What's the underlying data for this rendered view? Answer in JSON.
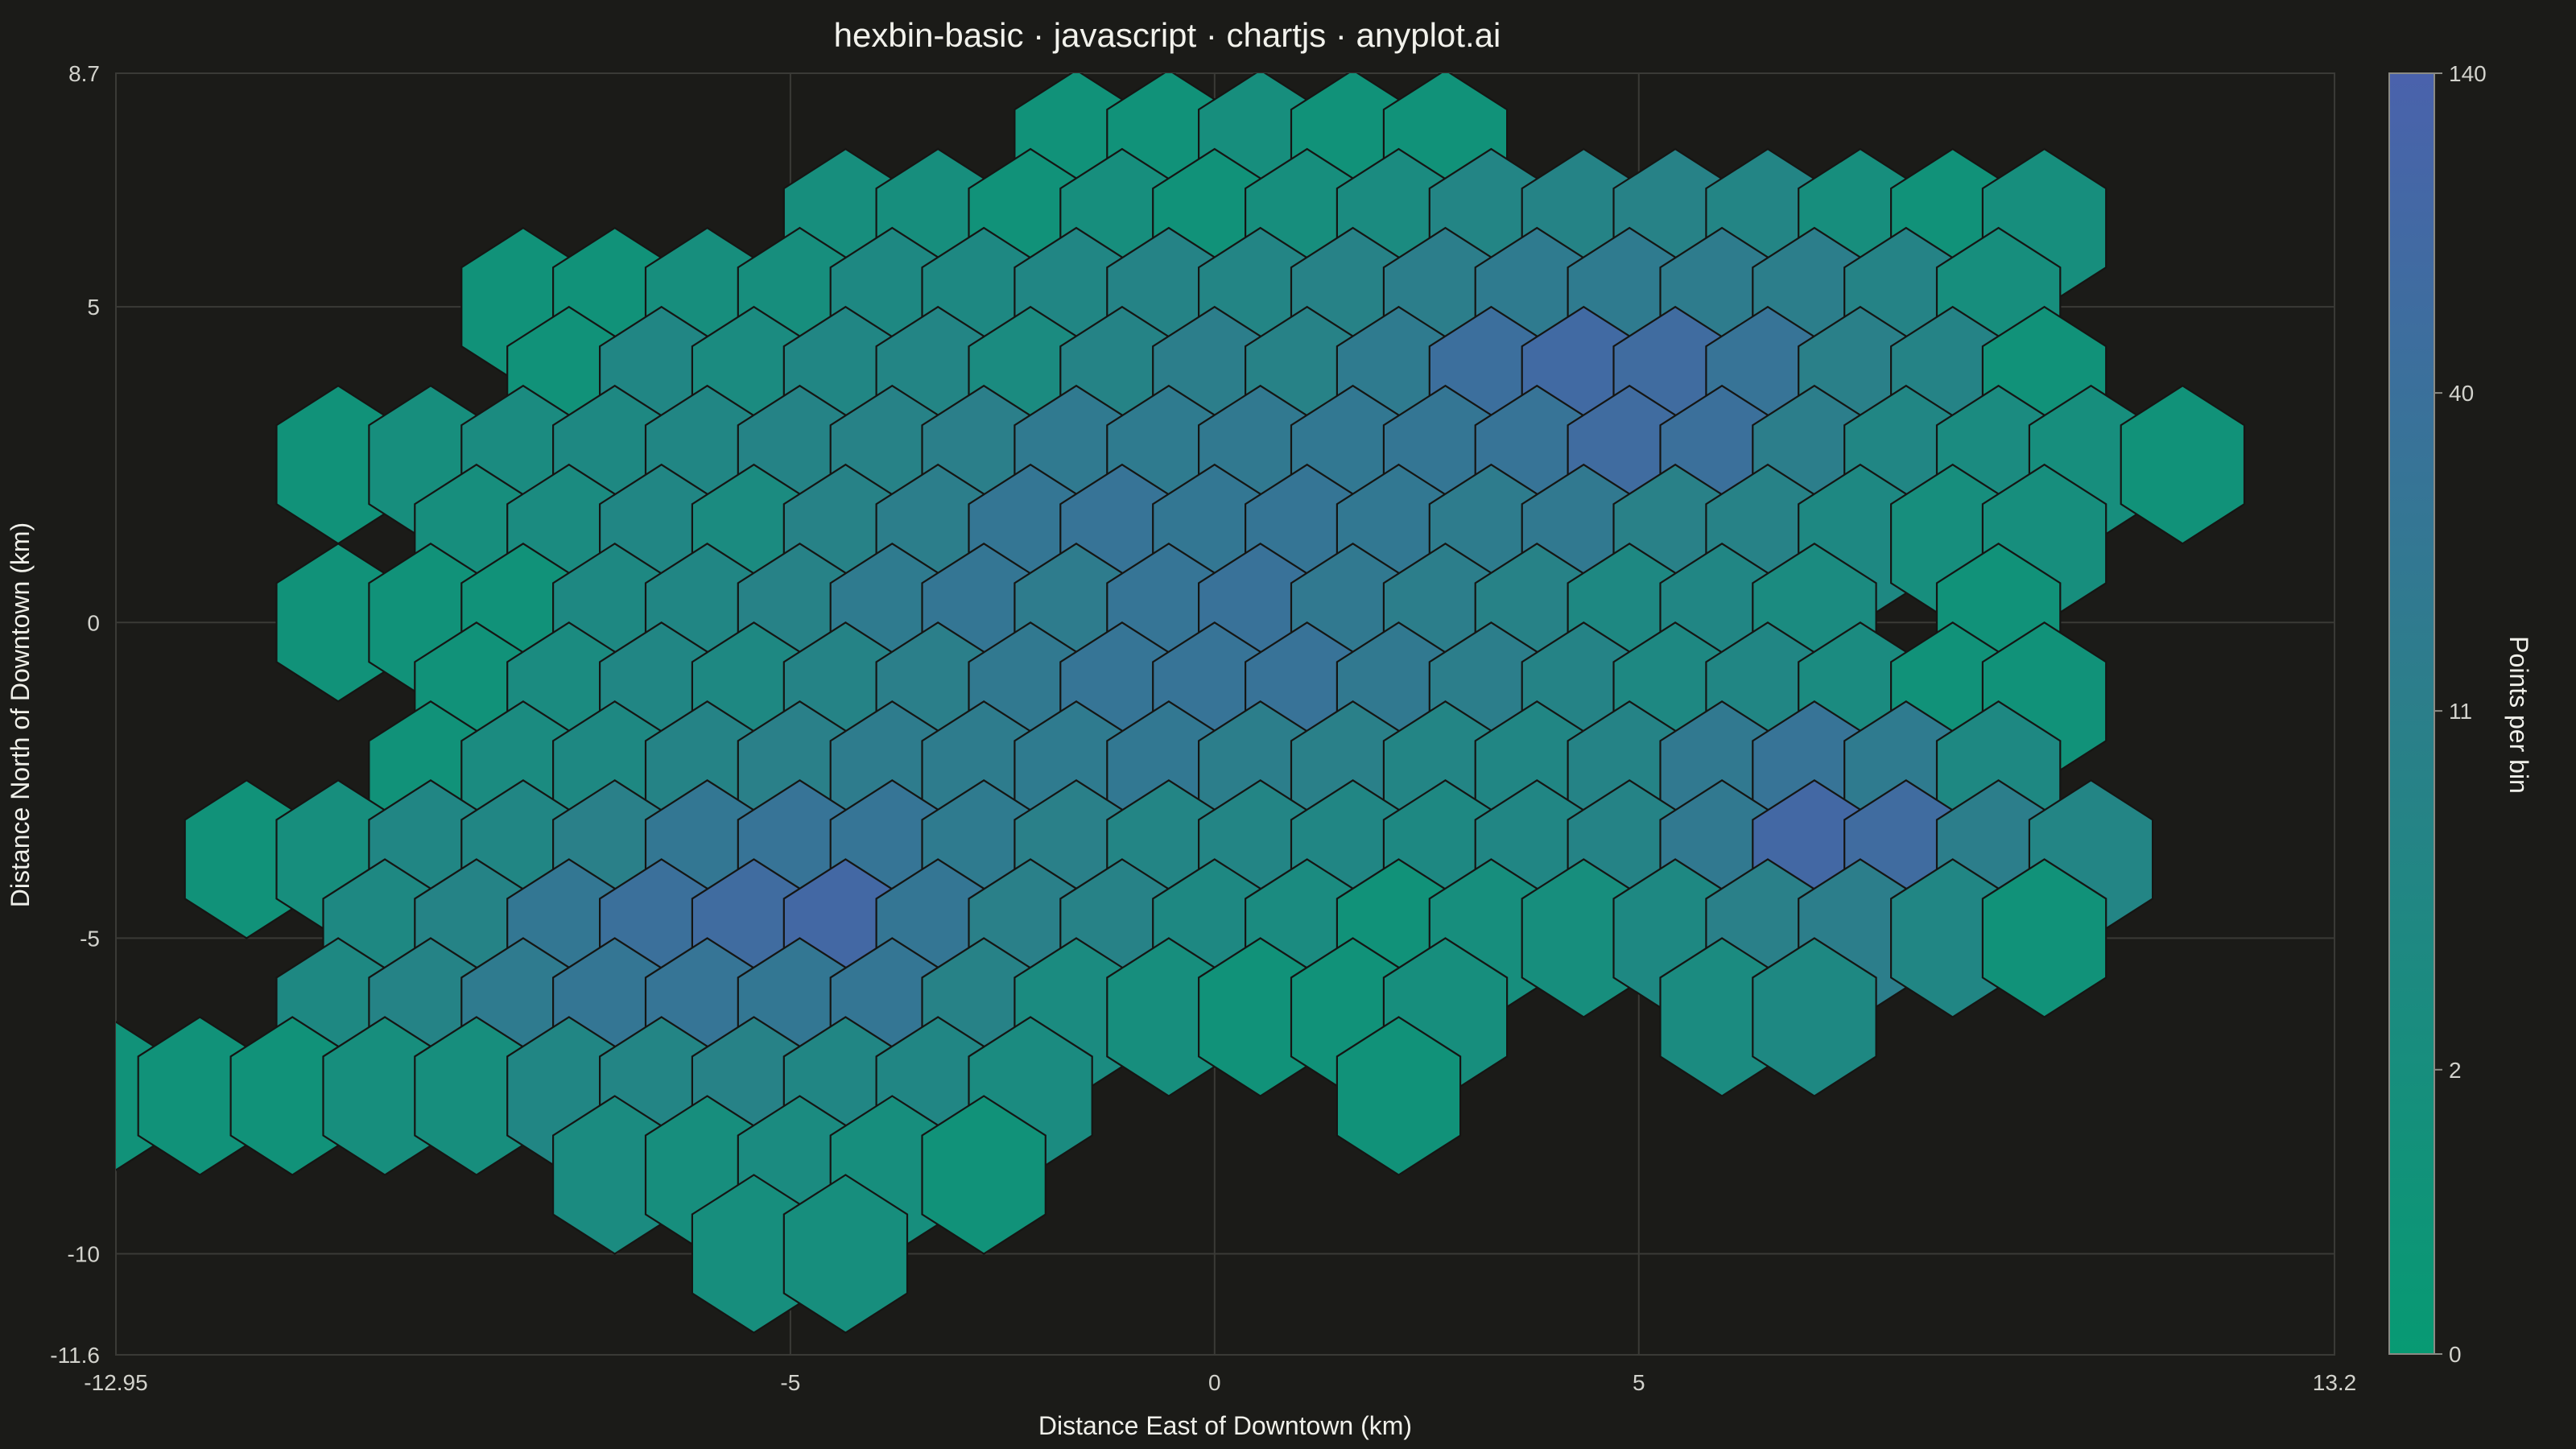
{
  "chart_data": {
    "type": "heatmap",
    "subtype": "hexbin",
    "title": "hexbin-basic · javascript · chartjs · anyplot.ai",
    "xlabel": "Distance East of Downtown (km)",
    "ylabel": "Distance North of Downtown (km)",
    "xlim": [
      -12.95,
      13.2
    ],
    "ylim": [
      -11.6,
      8.7
    ],
    "x_ticks": [
      -12.95,
      -5,
      0,
      5,
      13.2
    ],
    "y_ticks": [
      8.7,
      5,
      0,
      -5,
      -10,
      -11.6
    ],
    "grid": true,
    "hex_radius_km": 1.25,
    "colorbar": {
      "label": "Points per bin",
      "scale": "log",
      "ticks": [
        140,
        40,
        11,
        2,
        0
      ],
      "range": [
        0,
        140
      ],
      "color_low": "#079a73",
      "color_high": "#4a62ac"
    },
    "bins": [
      {
        "x": -1.63,
        "y": 7.5,
        "count": 1
      },
      {
        "x": -0.54,
        "y": 7.5,
        "count": 1
      },
      {
        "x": 0.54,
        "y": 7.5,
        "count": 2
      },
      {
        "x": 1.63,
        "y": 7.5,
        "count": 1
      },
      {
        "x": 2.72,
        "y": 7.5,
        "count": 1
      },
      {
        "x": -4.35,
        "y": 6.25,
        "count": 2
      },
      {
        "x": -3.26,
        "y": 6.25,
        "count": 2
      },
      {
        "x": -2.17,
        "y": 6.25,
        "count": 1
      },
      {
        "x": -1.09,
        "y": 6.25,
        "count": 2
      },
      {
        "x": 0.0,
        "y": 6.25,
        "count": 1
      },
      {
        "x": 1.09,
        "y": 6.25,
        "count": 2
      },
      {
        "x": 2.17,
        "y": 6.25,
        "count": 3
      },
      {
        "x": 3.26,
        "y": 6.25,
        "count": 6
      },
      {
        "x": 4.35,
        "y": 6.25,
        "count": 7
      },
      {
        "x": 5.43,
        "y": 6.25,
        "count": 8
      },
      {
        "x": 6.52,
        "y": 6.25,
        "count": 6
      },
      {
        "x": 7.61,
        "y": 6.25,
        "count": 2
      },
      {
        "x": 8.7,
        "y": 6.25,
        "count": 1
      },
      {
        "x": 9.78,
        "y": 6.25,
        "count": 2
      },
      {
        "x": -8.15,
        "y": 5.0,
        "count": 1
      },
      {
        "x": -7.07,
        "y": 5.0,
        "count": 1
      },
      {
        "x": -5.98,
        "y": 5.0,
        "count": 2
      },
      {
        "x": -4.89,
        "y": 5.0,
        "count": 2
      },
      {
        "x": -3.8,
        "y": 5.0,
        "count": 4
      },
      {
        "x": -2.72,
        "y": 5.0,
        "count": 4
      },
      {
        "x": -1.63,
        "y": 5.0,
        "count": 5
      },
      {
        "x": -0.54,
        "y": 5.0,
        "count": 7
      },
      {
        "x": 0.54,
        "y": 5.0,
        "count": 6
      },
      {
        "x": 1.63,
        "y": 5.0,
        "count": 8
      },
      {
        "x": 2.72,
        "y": 5.0,
        "count": 12
      },
      {
        "x": 3.8,
        "y": 5.0,
        "count": 16
      },
      {
        "x": 4.89,
        "y": 5.0,
        "count": 16
      },
      {
        "x": 5.98,
        "y": 5.0,
        "count": 14
      },
      {
        "x": 7.07,
        "y": 5.0,
        "count": 12
      },
      {
        "x": 8.15,
        "y": 5.0,
        "count": 7
      },
      {
        "x": 9.24,
        "y": 5.0,
        "count": 2
      },
      {
        "x": -7.61,
        "y": 3.75,
        "count": 1
      },
      {
        "x": -6.52,
        "y": 3.75,
        "count": 5
      },
      {
        "x": -5.43,
        "y": 3.75,
        "count": 3
      },
      {
        "x": -4.35,
        "y": 3.75,
        "count": 5
      },
      {
        "x": -3.26,
        "y": 3.75,
        "count": 6
      },
      {
        "x": -2.17,
        "y": 3.75,
        "count": 3
      },
      {
        "x": -1.09,
        "y": 3.75,
        "count": 7
      },
      {
        "x": 0.0,
        "y": 3.75,
        "count": 12
      },
      {
        "x": 1.09,
        "y": 3.75,
        "count": 8
      },
      {
        "x": 2.17,
        "y": 3.75,
        "count": 16
      },
      {
        "x": 3.26,
        "y": 3.75,
        "count": 45
      },
      {
        "x": 4.35,
        "y": 3.75,
        "count": 70
      },
      {
        "x": 5.43,
        "y": 3.75,
        "count": 60
      },
      {
        "x": 6.52,
        "y": 3.75,
        "count": 30
      },
      {
        "x": 7.61,
        "y": 3.75,
        "count": 10
      },
      {
        "x": 8.7,
        "y": 3.75,
        "count": 7
      },
      {
        "x": 9.78,
        "y": 3.75,
        "count": 1
      },
      {
        "x": -10.33,
        "y": 2.5,
        "count": 1
      },
      {
        "x": -9.24,
        "y": 2.5,
        "count": 2
      },
      {
        "x": -8.15,
        "y": 2.5,
        "count": 3
      },
      {
        "x": -7.07,
        "y": 2.5,
        "count": 4
      },
      {
        "x": -5.98,
        "y": 2.5,
        "count": 5
      },
      {
        "x": -4.89,
        "y": 2.5,
        "count": 7
      },
      {
        "x": -3.8,
        "y": 2.5,
        "count": 8
      },
      {
        "x": -2.72,
        "y": 2.5,
        "count": 11
      },
      {
        "x": -1.63,
        "y": 2.5,
        "count": 17
      },
      {
        "x": -0.54,
        "y": 2.5,
        "count": 16
      },
      {
        "x": 0.54,
        "y": 2.5,
        "count": 18
      },
      {
        "x": 1.63,
        "y": 2.5,
        "count": 20
      },
      {
        "x": 2.72,
        "y": 2.5,
        "count": 24
      },
      {
        "x": 3.8,
        "y": 2.5,
        "count": 30
      },
      {
        "x": 4.89,
        "y": 2.5,
        "count": 60
      },
      {
        "x": 5.98,
        "y": 2.5,
        "count": 40
      },
      {
        "x": 7.07,
        "y": 2.5,
        "count": 12
      },
      {
        "x": 8.15,
        "y": 2.5,
        "count": 5
      },
      {
        "x": 9.24,
        "y": 2.5,
        "count": 3
      },
      {
        "x": 10.33,
        "y": 2.5,
        "count": 2
      },
      {
        "x": 11.41,
        "y": 2.5,
        "count": 1
      },
      {
        "x": -8.7,
        "y": 1.25,
        "count": 2
      },
      {
        "x": -7.61,
        "y": 1.25,
        "count": 3
      },
      {
        "x": -6.52,
        "y": 1.25,
        "count": 5
      },
      {
        "x": -5.43,
        "y": 1.25,
        "count": 3
      },
      {
        "x": -4.35,
        "y": 1.25,
        "count": 8
      },
      {
        "x": -3.26,
        "y": 1.25,
        "count": 12
      },
      {
        "x": -2.17,
        "y": 1.25,
        "count": 24
      },
      {
        "x": -1.09,
        "y": 1.25,
        "count": 30
      },
      {
        "x": 0.0,
        "y": 1.25,
        "count": 22
      },
      {
        "x": 1.09,
        "y": 1.25,
        "count": 26
      },
      {
        "x": 2.17,
        "y": 1.25,
        "count": 20
      },
      {
        "x": 3.26,
        "y": 1.25,
        "count": 14
      },
      {
        "x": 4.35,
        "y": 1.25,
        "count": 18
      },
      {
        "x": 5.43,
        "y": 1.25,
        "count": 9
      },
      {
        "x": 6.52,
        "y": 1.25,
        "count": 8
      },
      {
        "x": 7.61,
        "y": 1.25,
        "count": 4
      },
      {
        "x": 8.7,
        "y": 1.25,
        "count": 2
      },
      {
        "x": 9.78,
        "y": 1.25,
        "count": 2
      },
      {
        "x": -10.33,
        "y": 0.0,
        "count": 1
      },
      {
        "x": -9.24,
        "y": 0.0,
        "count": 1
      },
      {
        "x": -8.15,
        "y": 0.0,
        "count": 1
      },
      {
        "x": -7.07,
        "y": 0.0,
        "count": 4
      },
      {
        "x": -5.98,
        "y": 0.0,
        "count": 5
      },
      {
        "x": -4.89,
        "y": 0.0,
        "count": 8
      },
      {
        "x": -3.8,
        "y": 0.0,
        "count": 16
      },
      {
        "x": -2.72,
        "y": 0.0,
        "count": 24
      },
      {
        "x": -1.63,
        "y": 0.0,
        "count": 14
      },
      {
        "x": -0.54,
        "y": 0.0,
        "count": 28
      },
      {
        "x": 0.54,
        "y": 0.0,
        "count": 34
      },
      {
        "x": 1.63,
        "y": 0.0,
        "count": 18
      },
      {
        "x": 2.72,
        "y": 0.0,
        "count": 12
      },
      {
        "x": 3.8,
        "y": 0.0,
        "count": 8
      },
      {
        "x": 4.89,
        "y": 0.0,
        "count": 4
      },
      {
        "x": 5.98,
        "y": 0.0,
        "count": 5
      },
      {
        "x": 7.07,
        "y": 0.0,
        "count": 3
      },
      {
        "x": 9.24,
        "y": 0.0,
        "count": 1
      },
      {
        "x": -8.7,
        "y": -1.25,
        "count": 1
      },
      {
        "x": -7.61,
        "y": -1.25,
        "count": 3
      },
      {
        "x": -6.52,
        "y": -1.25,
        "count": 5
      },
      {
        "x": -5.43,
        "y": -1.25,
        "count": 4
      },
      {
        "x": -4.35,
        "y": -1.25,
        "count": 7
      },
      {
        "x": -3.26,
        "y": -1.25,
        "count": 11
      },
      {
        "x": -2.17,
        "y": -1.25,
        "count": 18
      },
      {
        "x": -1.09,
        "y": -1.25,
        "count": 28
      },
      {
        "x": 0.0,
        "y": -1.25,
        "count": 30
      },
      {
        "x": 1.09,
        "y": -1.25,
        "count": 32
      },
      {
        "x": 2.17,
        "y": -1.25,
        "count": 18
      },
      {
        "x": 3.26,
        "y": -1.25,
        "count": 12
      },
      {
        "x": 4.35,
        "y": -1.25,
        "count": 7
      },
      {
        "x": 5.43,
        "y": -1.25,
        "count": 4
      },
      {
        "x": 6.52,
        "y": -1.25,
        "count": 5
      },
      {
        "x": 7.61,
        "y": -1.25,
        "count": 3
      },
      {
        "x": 8.7,
        "y": -1.25,
        "count": 1
      },
      {
        "x": 9.78,
        "y": -1.25,
        "count": 1
      },
      {
        "x": -9.24,
        "y": -2.5,
        "count": 1
      },
      {
        "x": -8.15,
        "y": -2.5,
        "count": 3
      },
      {
        "x": -7.07,
        "y": -2.5,
        "count": 4
      },
      {
        "x": -5.98,
        "y": -2.5,
        "count": 7
      },
      {
        "x": -4.89,
        "y": -2.5,
        "count": 10
      },
      {
        "x": -3.8,
        "y": -2.5,
        "count": 14
      },
      {
        "x": -2.72,
        "y": -2.5,
        "count": 14
      },
      {
        "x": -1.63,
        "y": -2.5,
        "count": 16
      },
      {
        "x": -0.54,
        "y": -2.5,
        "count": 20
      },
      {
        "x": 0.54,
        "y": -2.5,
        "count": 12
      },
      {
        "x": 1.63,
        "y": -2.5,
        "count": 10
      },
      {
        "x": 2.72,
        "y": -2.5,
        "count": 6
      },
      {
        "x": 3.8,
        "y": -2.5,
        "count": 5
      },
      {
        "x": 4.89,
        "y": -2.5,
        "count": 7
      },
      {
        "x": 5.98,
        "y": -2.5,
        "count": 18
      },
      {
        "x": 7.07,
        "y": -2.5,
        "count": 30
      },
      {
        "x": 8.15,
        "y": -2.5,
        "count": 16
      },
      {
        "x": 9.24,
        "y": -2.5,
        "count": 4
      },
      {
        "x": -11.41,
        "y": -3.75,
        "count": 1
      },
      {
        "x": -10.33,
        "y": -3.75,
        "count": 2
      },
      {
        "x": -9.24,
        "y": -3.75,
        "count": 5
      },
      {
        "x": -8.15,
        "y": -3.75,
        "count": 5
      },
      {
        "x": -7.07,
        "y": -3.75,
        "count": 10
      },
      {
        "x": -5.98,
        "y": -3.75,
        "count": 22
      },
      {
        "x": -4.89,
        "y": -3.75,
        "count": 30
      },
      {
        "x": -3.8,
        "y": -3.75,
        "count": 28
      },
      {
        "x": -2.72,
        "y": -3.75,
        "count": 16
      },
      {
        "x": -1.63,
        "y": -3.75,
        "count": 10
      },
      {
        "x": -0.54,
        "y": -3.75,
        "count": 6
      },
      {
        "x": 0.54,
        "y": -3.75,
        "count": 6
      },
      {
        "x": 1.63,
        "y": -3.75,
        "count": 5
      },
      {
        "x": 2.72,
        "y": -3.75,
        "count": 4
      },
      {
        "x": 3.8,
        "y": -3.75,
        "count": 5
      },
      {
        "x": 4.89,
        "y": -3.75,
        "count": 7
      },
      {
        "x": 5.98,
        "y": -3.75,
        "count": 18
      },
      {
        "x": 7.07,
        "y": -3.75,
        "count": 80
      },
      {
        "x": 8.15,
        "y": -3.75,
        "count": 60
      },
      {
        "x": 9.24,
        "y": -3.75,
        "count": 12
      },
      {
        "x": 10.33,
        "y": -3.75,
        "count": 6
      },
      {
        "x": -9.78,
        "y": -5.0,
        "count": 4
      },
      {
        "x": -8.7,
        "y": -5.0,
        "count": 7
      },
      {
        "x": -7.61,
        "y": -5.0,
        "count": 22
      },
      {
        "x": -6.52,
        "y": -5.0,
        "count": 40
      },
      {
        "x": -5.43,
        "y": -5.0,
        "count": 60
      },
      {
        "x": -4.35,
        "y": -5.0,
        "count": 80
      },
      {
        "x": -3.26,
        "y": -5.0,
        "count": 24
      },
      {
        "x": -2.17,
        "y": -5.0,
        "count": 10
      },
      {
        "x": -1.09,
        "y": -5.0,
        "count": 8
      },
      {
        "x": 0.0,
        "y": -5.0,
        "count": 4
      },
      {
        "x": 1.09,
        "y": -5.0,
        "count": 3
      },
      {
        "x": 2.17,
        "y": -5.0,
        "count": 1
      },
      {
        "x": 3.26,
        "y": -5.0,
        "count": 2
      },
      {
        "x": 4.35,
        "y": -5.0,
        "count": 2
      },
      {
        "x": 5.43,
        "y": -5.0,
        "count": 4
      },
      {
        "x": 6.52,
        "y": -5.0,
        "count": 10
      },
      {
        "x": 7.61,
        "y": -5.0,
        "count": 12
      },
      {
        "x": 8.7,
        "y": -5.0,
        "count": 5
      },
      {
        "x": 9.78,
        "y": -5.0,
        "count": 1
      },
      {
        "x": -10.33,
        "y": -6.25,
        "count": 4
      },
      {
        "x": -9.24,
        "y": -6.25,
        "count": 7
      },
      {
        "x": -8.15,
        "y": -6.25,
        "count": 16
      },
      {
        "x": -7.07,
        "y": -6.25,
        "count": 24
      },
      {
        "x": -5.98,
        "y": -6.25,
        "count": 28
      },
      {
        "x": -4.89,
        "y": -6.25,
        "count": 22
      },
      {
        "x": -3.8,
        "y": -6.25,
        "count": 24
      },
      {
        "x": -2.72,
        "y": -6.25,
        "count": 8
      },
      {
        "x": -1.63,
        "y": -6.25,
        "count": 3
      },
      {
        "x": -0.54,
        "y": -6.25,
        "count": 2
      },
      {
        "x": 0.54,
        "y": -6.25,
        "count": 1
      },
      {
        "x": 1.63,
        "y": -6.25,
        "count": 1
      },
      {
        "x": 2.72,
        "y": -6.25,
        "count": 2
      },
      {
        "x": 5.98,
        "y": -6.25,
        "count": 3
      },
      {
        "x": 7.07,
        "y": -6.25,
        "count": 4
      },
      {
        "x": -13.04,
        "y": -7.5,
        "count": 1
      },
      {
        "x": -11.96,
        "y": -7.5,
        "count": 1
      },
      {
        "x": -10.87,
        "y": -7.5,
        "count": 1
      },
      {
        "x": -9.78,
        "y": -7.5,
        "count": 2
      },
      {
        "x": -8.7,
        "y": -7.5,
        "count": 2
      },
      {
        "x": -7.61,
        "y": -7.5,
        "count": 5
      },
      {
        "x": -6.52,
        "y": -7.5,
        "count": 6
      },
      {
        "x": -5.43,
        "y": -7.5,
        "count": 8
      },
      {
        "x": -4.35,
        "y": -7.5,
        "count": 5
      },
      {
        "x": -3.26,
        "y": -7.5,
        "count": 5
      },
      {
        "x": -2.17,
        "y": -7.5,
        "count": 3
      },
      {
        "x": 2.17,
        "y": -7.5,
        "count": 1
      },
      {
        "x": -7.07,
        "y": -8.75,
        "count": 3
      },
      {
        "x": -5.98,
        "y": -8.75,
        "count": 2
      },
      {
        "x": -4.89,
        "y": -8.75,
        "count": 3
      },
      {
        "x": -3.8,
        "y": -8.75,
        "count": 2
      },
      {
        "x": -2.72,
        "y": -8.75,
        "count": 1
      },
      {
        "x": -5.43,
        "y": -10.0,
        "count": 2
      },
      {
        "x": -4.35,
        "y": -10.0,
        "count": 2
      }
    ]
  }
}
